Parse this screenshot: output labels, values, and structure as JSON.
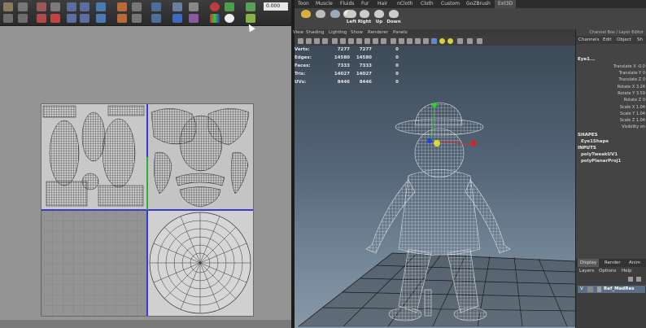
{
  "uv_editor": {
    "value_field": "0.000",
    "colors": {
      "panel_bg": "#949494",
      "uv_axis": "#3a3ad0",
      "uv_axis_green": "#30b030"
    }
  },
  "maya": {
    "menu_tabs": [
      "Toon",
      "Muscle",
      "Fluids",
      "Fur",
      "Hair",
      "nCloth",
      "Cloth",
      "Custom",
      "GoZBrush",
      "Ext3D"
    ],
    "active_tab": "Ext3D",
    "shelf_buttons": [
      {
        "label": "",
        "icon": "brush-icon"
      },
      {
        "label": "",
        "icon": "render-icon"
      },
      {
        "label": "",
        "icon": "hypershade-icon"
      },
      {
        "label": "",
        "icon": "sphere-icon"
      },
      {
        "label": "Left",
        "icon": "camera-left-icon"
      },
      {
        "label": "Right",
        "icon": "camera-right-icon"
      },
      {
        "label": "Up",
        "icon": "camera-up-icon"
      },
      {
        "label": "Down",
        "icon": "camera-down-icon"
      }
    ],
    "viewport_menu": [
      "View",
      "Shading",
      "Lighting",
      "Show",
      "Renderer",
      "Panels"
    ],
    "hud": [
      {
        "label": "Verts:",
        "a": "7277",
        "b": "7277",
        "c": "0"
      },
      {
        "label": "Edges:",
        "a": "14580",
        "b": "14580",
        "c": "0"
      },
      {
        "label": "Faces:",
        "a": "7333",
        "b": "7333",
        "c": "0"
      },
      {
        "label": "Tris:",
        "a": "14027",
        "b": "14027",
        "c": "0"
      },
      {
        "label": "UVs:",
        "a": "8446",
        "b": "8446",
        "c": "0"
      }
    ],
    "channel_box": {
      "title": "Channel Box / Layer Editor",
      "menu": [
        "Channels",
        "Edit",
        "Object",
        "Sh"
      ],
      "object_name": "Eye1...",
      "attributes": [
        {
          "name": "Translate X",
          "value": "-0.0"
        },
        {
          "name": "Translate Y",
          "value": "0"
        },
        {
          "name": "Translate Z",
          "value": "0"
        },
        {
          "name": "Rotate X",
          "value": "3.24"
        },
        {
          "name": "Rotate Y",
          "value": "3.59"
        },
        {
          "name": "Rotate Z",
          "value": "0"
        },
        {
          "name": "Scale X",
          "value": "1.04"
        },
        {
          "name": "Scale Y",
          "value": "1.04"
        },
        {
          "name": "Scale Z",
          "value": "1.04"
        },
        {
          "name": "Visibility",
          "value": "on"
        }
      ],
      "shapes_header": "SHAPES",
      "shape_name": "Eye1Shape",
      "inputs_header": "INPUTS",
      "inputs": [
        "polyTweakUV1",
        "polyPlanarProj1"
      ]
    },
    "layer_editor": {
      "tabs": [
        "Display",
        "Render",
        "Anim"
      ],
      "menu": [
        "Layers",
        "Options",
        "Help"
      ],
      "layer": {
        "v": "V",
        "name": "Ref_MedRes"
      }
    }
  }
}
